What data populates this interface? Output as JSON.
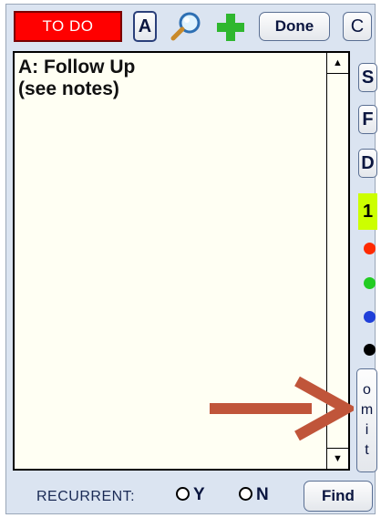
{
  "toolbar": {
    "todo_label": "TO DO",
    "a_label": "A",
    "search_icon": "magnifier-icon",
    "add_icon": "plus-icon",
    "done_label": "Done",
    "c_label": "C"
  },
  "colors": {
    "todo_bg": "#ff0000",
    "priority_bg": "#ccff00",
    "red_dot": "#ff2a00",
    "green_dot": "#22cc22",
    "blue_dot": "#1f3fd9",
    "black_dot": "#000000",
    "arrow": "#c0553a"
  },
  "notes": {
    "text": "A: Follow Up\n(see notes)"
  },
  "side": {
    "s_label": "S",
    "f_label": "F",
    "d_label": "D",
    "priority_value": "1",
    "omit_letters": [
      "o",
      "m",
      "i",
      "t"
    ]
  },
  "footer": {
    "recurrent_label": "RECURRENT:",
    "yes_label": "Y",
    "no_label": "N",
    "find_label": "Find"
  }
}
